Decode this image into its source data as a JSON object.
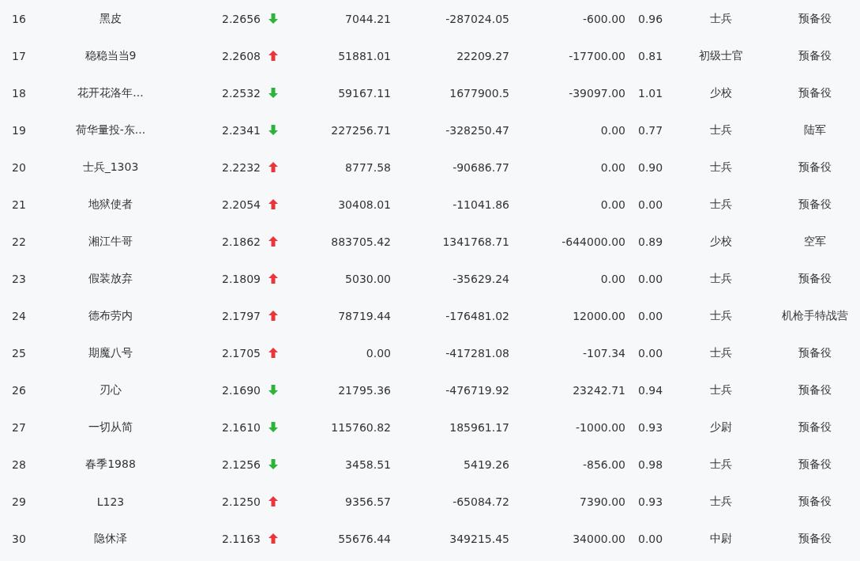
{
  "table": {
    "rows": [
      {
        "rank": "16",
        "name": "黑皮",
        "value": "2.2656",
        "rising": false,
        "column_5": "7044.21",
        "column_6": "-287024.05",
        "column_7": "-600.00",
        "column_8": "0.96",
        "column_9": "士兵",
        "column_10": "预备役"
      },
      {
        "rank": "17",
        "name": "稳稳当当9",
        "value": "2.2608",
        "rising": true,
        "column_5": "51881.01",
        "column_6": "22209.27",
        "column_7": "-17700.00",
        "column_8": "0.81",
        "column_9": "初级士官",
        "column_10": "预备役"
      },
      {
        "rank": "18",
        "name": "花开花洛年...",
        "value": "2.2532",
        "rising": false,
        "column_5": "59167.11",
        "column_6": "1677900.5",
        "column_7": "-39097.00",
        "column_8": "1.01",
        "column_9": "少校",
        "column_10": "预备役"
      },
      {
        "rank": "19",
        "name": "荷华量投-东...",
        "value": "2.2341",
        "rising": false,
        "column_5": "227256.71",
        "column_6": "-328250.47",
        "column_7": "0.00",
        "column_8": "0.77",
        "column_9": "士兵",
        "column_10": "陆军"
      },
      {
        "rank": "20",
        "name": "士兵_1303",
        "value": "2.2232",
        "rising": true,
        "column_5": "8777.58",
        "column_6": "-90686.77",
        "column_7": "0.00",
        "column_8": "0.90",
        "column_9": "士兵",
        "column_10": "预备役"
      },
      {
        "rank": "21",
        "name": "地狱使者",
        "value": "2.2054",
        "rising": true,
        "column_5": "30408.01",
        "column_6": "-11041.86",
        "column_7": "0.00",
        "column_8": "0.00",
        "column_9": "士兵",
        "column_10": "预备役"
      },
      {
        "rank": "22",
        "name": "湘江牛哥",
        "value": "2.1862",
        "rising": true,
        "column_5": "883705.42",
        "column_6": "1341768.71",
        "column_7": "-644000.00",
        "column_8": "0.89",
        "column_9": "少校",
        "column_10": "空军"
      },
      {
        "rank": "23",
        "name": "假装放弃",
        "value": "2.1809",
        "rising": true,
        "column_5": "5030.00",
        "column_6": "-35629.24",
        "column_7": "0.00",
        "column_8": "0.00",
        "column_9": "士兵",
        "column_10": "预备役"
      },
      {
        "rank": "24",
        "name": "德布劳内",
        "value": "2.1797",
        "rising": true,
        "column_5": "78719.44",
        "column_6": "-176481.02",
        "column_7": "12000.00",
        "column_8": "0.00",
        "column_9": "士兵",
        "column_10": "机枪手特战营"
      },
      {
        "rank": "25",
        "name": "期魔八号",
        "value": "2.1705",
        "rising": true,
        "column_5": "0.00",
        "column_6": "-417281.08",
        "column_7": "-107.34",
        "column_8": "0.00",
        "column_9": "士兵",
        "column_10": "预备役"
      },
      {
        "rank": "26",
        "name": "刃心",
        "value": "2.1690",
        "rising": false,
        "column_5": "21795.36",
        "column_6": "-476719.92",
        "column_7": "23242.71",
        "column_8": "0.94",
        "column_9": "士兵",
        "column_10": "预备役"
      },
      {
        "rank": "27",
        "name": "一切从简",
        "value": "2.1610",
        "rising": false,
        "column_5": "115760.82",
        "column_6": "185961.17",
        "column_7": "-1000.00",
        "column_8": "0.93",
        "column_9": "少尉",
        "column_10": "预备役"
      },
      {
        "rank": "28",
        "name": "春季1988",
        "value": "2.1256",
        "rising": false,
        "column_5": "3458.51",
        "column_6": "5419.26",
        "column_7": "-856.00",
        "column_8": "0.98",
        "column_9": "士兵",
        "column_10": "预备役"
      },
      {
        "rank": "29",
        "name": "L123",
        "value": "2.1250",
        "rising": true,
        "column_5": "9356.57",
        "column_6": "-65084.72",
        "column_7": "7390.00",
        "column_8": "0.93",
        "column_9": "士兵",
        "column_10": "预备役"
      },
      {
        "rank": "30",
        "name": "隐休泽",
        "value": "2.1163",
        "rising": true,
        "column_5": "55676.44",
        "column_6": "349215.45",
        "column_7": "34000.00",
        "column_8": "0.00",
        "column_9": "中尉",
        "column_10": "预备役"
      }
    ]
  }
}
